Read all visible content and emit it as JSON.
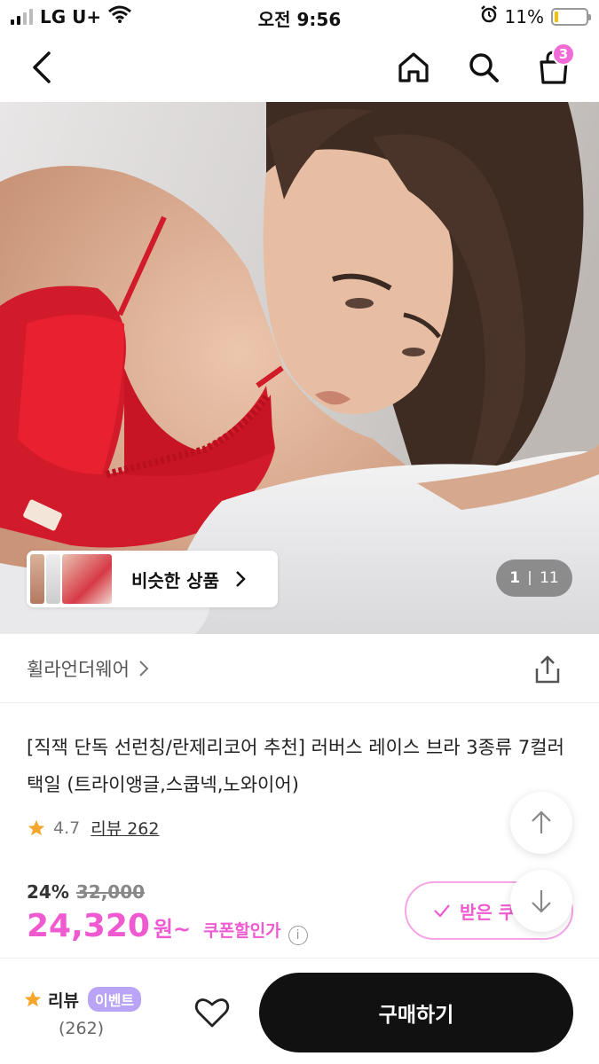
{
  "status_bar": {
    "carrier": "LG U+",
    "time": "오전 9:56",
    "battery_percent": "11%",
    "battery_level": 0.11,
    "icons": [
      "signal-icon",
      "wifi-icon",
      "alarm-icon",
      "battery-icon"
    ]
  },
  "nav": {
    "icons": [
      "back-arrow-icon",
      "home-icon",
      "search-icon",
      "shopping-bag-icon"
    ],
    "cart_count": "3",
    "badge_color": "#f26ad6"
  },
  "gallery": {
    "similar_label": "비슷한 상품",
    "current_page": "1",
    "total_pages": "11"
  },
  "brand": {
    "name": "휠라언더웨어"
  },
  "product": {
    "title": "[직잭 단독 선런칭/란제리코어 추천] 러버스 레이스 브라 3종류 7컬러 택일 (트라이앵글,스쿱넥,노와이어)",
    "rating": "4.7",
    "review_link": "리뷰 262"
  },
  "price": {
    "discount": "24%",
    "original": "32,000",
    "sale": "24,320",
    "sale_unit": "원~",
    "coupon_label": "쿠폰할인가",
    "coupon_button": "받은 쿠",
    "accent_color": "#f05ad1"
  },
  "bottom_bar": {
    "review_label": "리뷰",
    "event_badge": "이벤트",
    "review_count": "(262)",
    "buy_label": "구매하기"
  }
}
